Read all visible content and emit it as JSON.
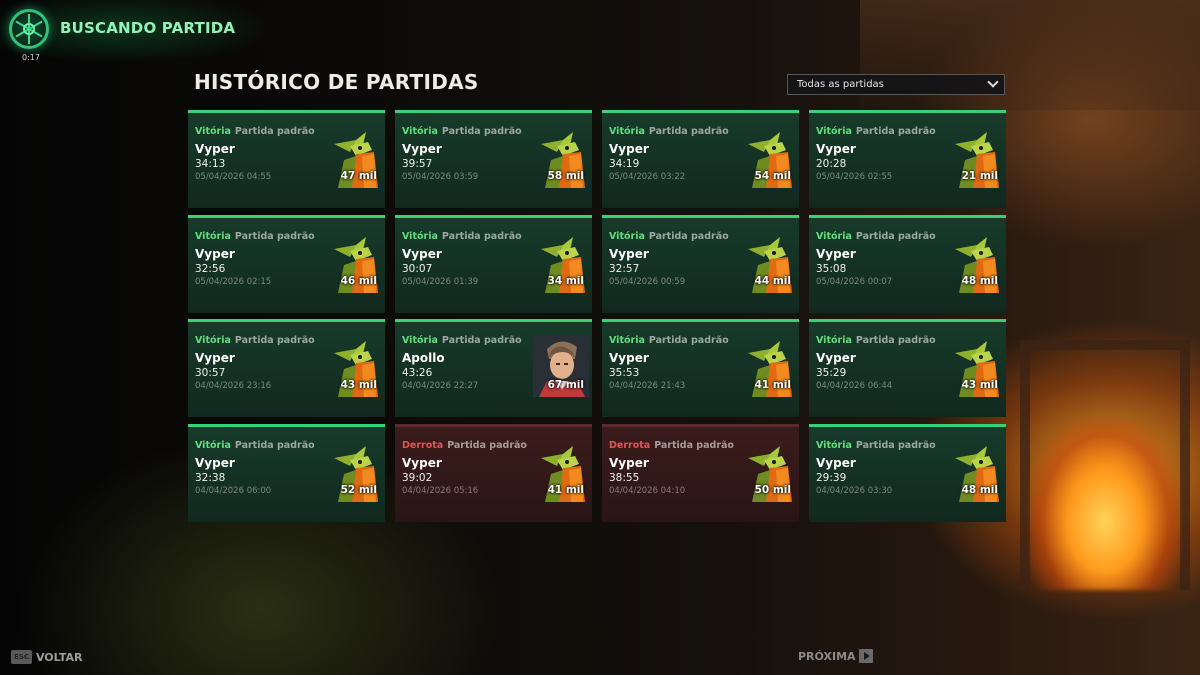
{
  "matchmaking": {
    "title": "BUSCANDO PARTIDA",
    "timer": "0:17"
  },
  "page": {
    "title": "HISTÓRICO DE PARTIDAS"
  },
  "filter": {
    "selected": "Todas as partidas"
  },
  "colors": {
    "victory": "#5ee07e",
    "defeat": "#e0555a",
    "accent": "#8ff5b7"
  },
  "matches": [
    {
      "result": "Vitória",
      "mode": "Partida padrão",
      "hero": "Vyper",
      "duration": "34:13",
      "date": "05/04/2026 04:55",
      "networth": "47 mil",
      "icon": "vyper-portrait-icon"
    },
    {
      "result": "Vitória",
      "mode": "Partida padrão",
      "hero": "Vyper",
      "duration": "39:57",
      "date": "05/04/2026 03:59",
      "networth": "58 mil",
      "icon": "vyper-portrait-icon"
    },
    {
      "result": "Vitória",
      "mode": "Partida padrão",
      "hero": "Vyper",
      "duration": "34:19",
      "date": "05/04/2026 03:22",
      "networth": "54 mil",
      "icon": "vyper-portrait-icon"
    },
    {
      "result": "Vitória",
      "mode": "Partida padrão",
      "hero": "Vyper",
      "duration": "20:28",
      "date": "05/04/2026 02:55",
      "networth": "21 mil",
      "icon": "vyper-portrait-icon"
    },
    {
      "result": "Vitória",
      "mode": "Partida padrão",
      "hero": "Vyper",
      "duration": "32:56",
      "date": "05/04/2026 02:15",
      "networth": "46 mil",
      "icon": "vyper-portrait-icon"
    },
    {
      "result": "Vitória",
      "mode": "Partida padrão",
      "hero": "Vyper",
      "duration": "30:07",
      "date": "05/04/2026 01:39",
      "networth": "34 mil",
      "icon": "vyper-portrait-icon"
    },
    {
      "result": "Vitória",
      "mode": "Partida padrão",
      "hero": "Vyper",
      "duration": "32:57",
      "date": "05/04/2026 00:59",
      "networth": "44 mil",
      "icon": "vyper-portrait-icon"
    },
    {
      "result": "Vitória",
      "mode": "Partida padrão",
      "hero": "Vyper",
      "duration": "35:08",
      "date": "05/04/2026 00:07",
      "networth": "48 mil",
      "icon": "vyper-portrait-icon"
    },
    {
      "result": "Vitória",
      "mode": "Partida padrão",
      "hero": "Vyper",
      "duration": "30:57",
      "date": "04/04/2026 23:16",
      "networth": "43 mil",
      "icon": "vyper-portrait-icon"
    },
    {
      "result": "Vitória",
      "mode": "Partida padrão",
      "hero": "Apollo",
      "duration": "43:26",
      "date": "04/04/2026 22:27",
      "networth": "67 mil",
      "icon": "apollo-portrait-icon"
    },
    {
      "result": "Vitória",
      "mode": "Partida padrão",
      "hero": "Vyper",
      "duration": "35:53",
      "date": "04/04/2026 21:43",
      "networth": "41 mil",
      "icon": "vyper-portrait-icon"
    },
    {
      "result": "Vitória",
      "mode": "Partida padrão",
      "hero": "Vyper",
      "duration": "35:29",
      "date": "04/04/2026 06:44",
      "networth": "43 mil",
      "icon": "vyper-portrait-icon"
    },
    {
      "result": "Vitória",
      "mode": "Partida padrão",
      "hero": "Vyper",
      "duration": "32:38",
      "date": "04/04/2026 06:00",
      "networth": "52 mil",
      "icon": "vyper-portrait-icon"
    },
    {
      "result": "Derrota",
      "mode": "Partida padrão",
      "hero": "Vyper",
      "duration": "39:02",
      "date": "04/04/2026 05:16",
      "networth": "41 mil",
      "icon": "vyper-portrait-icon"
    },
    {
      "result": "Derrota",
      "mode": "Partida padrão",
      "hero": "Vyper",
      "duration": "38:55",
      "date": "04/04/2026 04:10",
      "networth": "50 mil",
      "icon": "vyper-portrait-icon"
    },
    {
      "result": "Vitória",
      "mode": "Partida padrão",
      "hero": "Vyper",
      "duration": "29:39",
      "date": "04/04/2026 03:30",
      "networth": "48 mil",
      "icon": "vyper-portrait-icon"
    }
  ],
  "nav": {
    "esc_key": "ESC",
    "back_label": "VOLTAR",
    "next_label": "PRÓXIMA"
  }
}
